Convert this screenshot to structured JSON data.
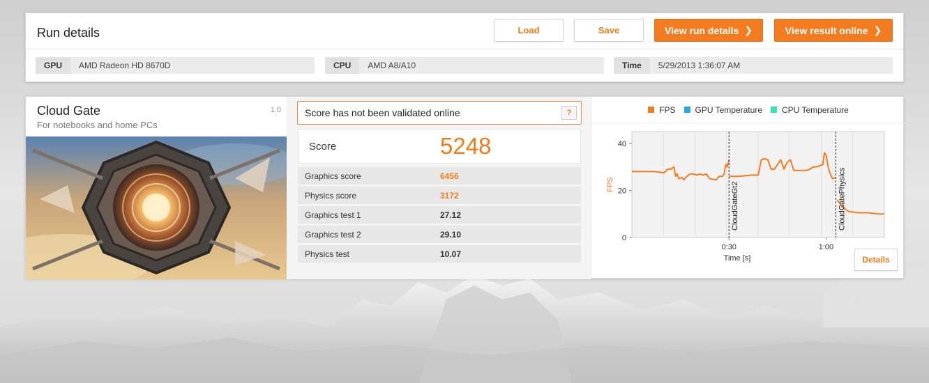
{
  "run": {
    "title": "Run details",
    "buttons": {
      "load": "Load",
      "save": "Save",
      "view_run_details": "View run details",
      "view_result_online": "View result online"
    },
    "gpu": {
      "label": "GPU",
      "value": "AMD Radeon HD 8670D"
    },
    "cpu": {
      "label": "CPU",
      "value": "AMD A8/A10"
    },
    "time": {
      "label": "Time",
      "value": "5/29/2013 1:36:07 AM"
    }
  },
  "benchmark": {
    "name": "Cloud Gate",
    "subtitle": "For notebooks and home PCs",
    "version": "1.0"
  },
  "validation": {
    "message": "Score has not been validated online",
    "help": "?"
  },
  "score": {
    "label": "Score",
    "value": "5248"
  },
  "rows": [
    {
      "label": "Graphics score",
      "value": "6456",
      "highlight": true
    },
    {
      "label": "Physics score",
      "value": "3172",
      "highlight": true
    },
    {
      "label": "Graphics test 1",
      "value": "27.12",
      "highlight": false
    },
    {
      "label": "Graphics test 2",
      "value": "29.10",
      "highlight": false
    },
    {
      "label": "Physics test",
      "value": "10.07",
      "highlight": false
    }
  ],
  "legend": [
    {
      "name": "FPS",
      "color": "#f47c20"
    },
    {
      "name": "GPU Temperature",
      "color": "#29a8e0"
    },
    {
      "name": "CPU Temperature",
      "color": "#2ee8b0"
    }
  ],
  "details_button": "Details",
  "chart_data": {
    "type": "line",
    "xlabel": "Time [s]",
    "ylabel": "FPS",
    "ylim": [
      0,
      45
    ],
    "xlim": [
      0,
      78
    ],
    "x_ticks": [
      {
        "value": 30,
        "label": "0:30"
      },
      {
        "value": 60,
        "label": "1:00"
      }
    ],
    "y_ticks": [
      0,
      20,
      40
    ],
    "grid": true,
    "markers": [
      {
        "x": 30,
        "label": "CloudGateGt2"
      },
      {
        "x": 63,
        "label": "CloudGatePhysics"
      }
    ],
    "series": [
      {
        "name": "FPS",
        "segments": [
          [
            [
              0,
              28
            ],
            [
              3,
              28
            ],
            [
              7,
              28
            ],
            [
              10,
              27.5
            ],
            [
              11,
              29
            ],
            [
              12,
              29
            ],
            [
              13,
              30
            ],
            [
              13.5,
              26
            ],
            [
              14,
              27
            ],
            [
              14.5,
              25
            ],
            [
              15.5,
              25.5
            ],
            [
              16,
              24.5
            ],
            [
              17,
              26
            ],
            [
              18,
              27
            ],
            [
              19,
              27
            ],
            [
              20,
              26.5
            ],
            [
              21,
              27
            ],
            [
              22,
              26.5
            ],
            [
              23,
              27
            ],
            [
              24,
              25
            ],
            [
              26,
              24.5
            ],
            [
              27,
              26
            ],
            [
              28,
              26
            ],
            [
              28.5,
              27
            ],
            [
              29,
              31
            ],
            [
              29.5,
              30
            ],
            [
              30,
              33
            ]
          ],
          [
            [
              30,
              26
            ],
            [
              33,
              26
            ],
            [
              37,
              26.5
            ],
            [
              39,
              26.5
            ],
            [
              40,
              33
            ],
            [
              41,
              33.5
            ],
            [
              42,
              33
            ],
            [
              43,
              29
            ],
            [
              44,
              29
            ],
            [
              45,
              31
            ],
            [
              46,
              33
            ],
            [
              47,
              29
            ],
            [
              48,
              32
            ],
            [
              49,
              33
            ],
            [
              50,
              28.5
            ],
            [
              54,
              28.5
            ],
            [
              55,
              29
            ],
            [
              56,
              30
            ],
            [
              57,
              30
            ],
            [
              58,
              30.5
            ],
            [
              59,
              31
            ],
            [
              59.5,
              36
            ],
            [
              60,
              35
            ],
            [
              60.5,
              31
            ],
            [
              61,
              28
            ],
            [
              62,
              25
            ],
            [
              63,
              25.5
            ]
          ],
          [
            [
              63.5,
              16
            ],
            [
              65,
              13
            ],
            [
              67,
              11
            ],
            [
              70,
              10.5
            ],
            [
              73,
              10.5
            ],
            [
              76,
              10
            ],
            [
              78,
              10
            ]
          ]
        ]
      }
    ]
  }
}
